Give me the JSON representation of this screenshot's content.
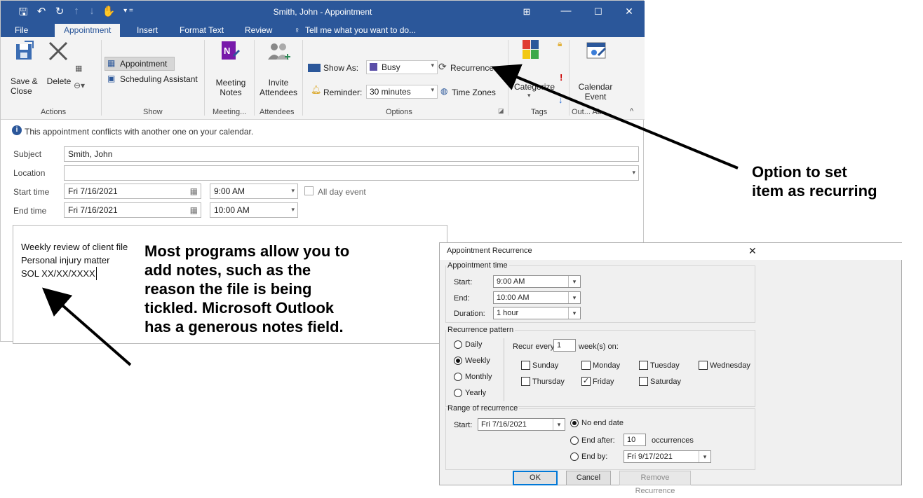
{
  "window": {
    "title": "Smith, John - Appointment",
    "tabs": [
      "File",
      "Appointment",
      "Insert",
      "Format Text",
      "Review"
    ],
    "tell_me": "Tell me what you want to do..."
  },
  "ribbon": {
    "save_close": "Save &\nClose",
    "delete": "Delete",
    "appointment": "Appointment",
    "scheduling": "Scheduling Assistant",
    "meeting_notes": "Meeting\nNotes",
    "invite": "Invite\nAttendees",
    "show_as_label": "Show As:",
    "show_as_value": "Busy",
    "recurrence": "Recurrence",
    "reminder_label": "Reminder:",
    "reminder_value": "30 minutes",
    "time_zones": "Time Zones",
    "categorize": "Categorize",
    "calendar_event": "Calendar\nEvent",
    "groups": {
      "actions": "Actions",
      "show": "Show",
      "meeting": "Meeting...",
      "attendees": "Attendees",
      "options": "Options",
      "tags": "Tags",
      "outlook": "Out... Ab..."
    }
  },
  "info_bar": "This appointment conflicts with another one on your calendar.",
  "form": {
    "subject_label": "Subject",
    "subject_value": "Smith, John",
    "location_label": "Location",
    "start_label": "Start time",
    "start_date": "Fri 7/16/2021",
    "start_time": "9:00 AM",
    "all_day": "All day event",
    "end_label": "End time",
    "end_date": "Fri 7/16/2021",
    "end_time": "10:00 AM"
  },
  "notes": [
    "Weekly review of client file",
    "Personal injury matter",
    "SOL XX/XX/XXXX"
  ],
  "dialog": {
    "title": "Appointment Recurrence",
    "time_legend": "Appointment time",
    "start_label": "Start:",
    "start_value": "9:00 AM",
    "end_label": "End:",
    "end_value": "10:00 AM",
    "duration_label": "Duration:",
    "duration_value": "1 hour",
    "pattern_legend": "Recurrence pattern",
    "daily": "Daily",
    "weekly": "Weekly",
    "monthly": "Monthly",
    "yearly": "Yearly",
    "recur_every": "Recur every",
    "recur_value": "1",
    "weeks_on": "week(s) on:",
    "days": [
      "Sunday",
      "Monday",
      "Tuesday",
      "Wednesday",
      "Thursday",
      "Friday",
      "Saturday"
    ],
    "checked_day": "Friday",
    "range_legend": "Range of recurrence",
    "range_start_label": "Start:",
    "range_start_value": "Fri 7/16/2021",
    "no_end": "No end date",
    "end_after": "End after:",
    "end_after_value": "10",
    "occurrences": "occurrences",
    "end_by": "End by:",
    "end_by_value": "Fri 9/17/2021",
    "ok": "OK",
    "cancel": "Cancel",
    "remove": "Remove Recurrence"
  },
  "annotations": {
    "recurring": "Option to set\nitem as recurring",
    "notes": "Most programs allow you to\nadd notes, such as the\nreason the file is being\ntickled. Microsoft Outlook\nhas a generous notes field."
  },
  "colors": {
    "title_bar": "#2b579a",
    "ribbon": "#f3f3f3",
    "accent": "#2b579a"
  }
}
